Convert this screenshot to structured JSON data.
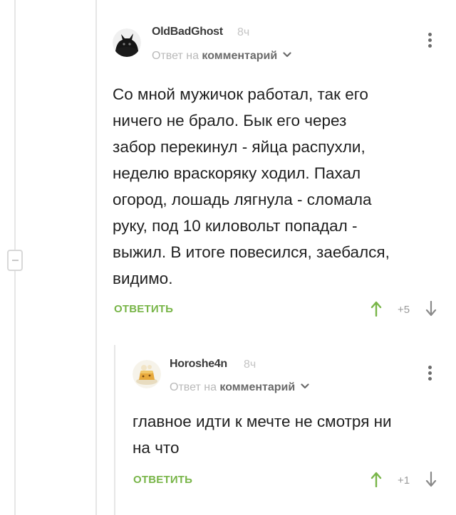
{
  "thread": {
    "collapse_label": "−"
  },
  "comments": [
    {
      "author": "OldBadGhost",
      "time": "8ч",
      "reply_prefix": "Ответ на",
      "reply_target": "комментарий",
      "text_lines": [
        "Со мной мужичок работал, так его",
        "ничего не брало. Бык его через",
        "забор перекинул - яйца распухли,",
        "неделю враскоряку ходил. Пахал",
        "огород, лошадь лягнула - сломала",
        "руку, под 10 киловольт попадал -",
        "выжил. В итоге повесился, заебался,",
        "видимо."
      ],
      "reply_label": "ОТВЕТИТЬ",
      "score": "+5"
    },
    {
      "author": "Horoshe4n",
      "time": "8ч",
      "reply_prefix": "Ответ на",
      "reply_target": "комментарий",
      "text_lines": [
        "главное идти к мечте не смотря ни",
        "на что"
      ],
      "reply_label": "ОТВЕТИТЬ",
      "score": "+1"
    }
  ],
  "colors": {
    "accent_green": "#78b548",
    "muted_text": "#b9b9b9",
    "thread_line": "#e6e6e6"
  },
  "icons": [
    "collapse-minus-icon",
    "chevron-down-icon",
    "more-vertical-icon",
    "arrow-up-icon",
    "arrow-down-icon"
  ]
}
